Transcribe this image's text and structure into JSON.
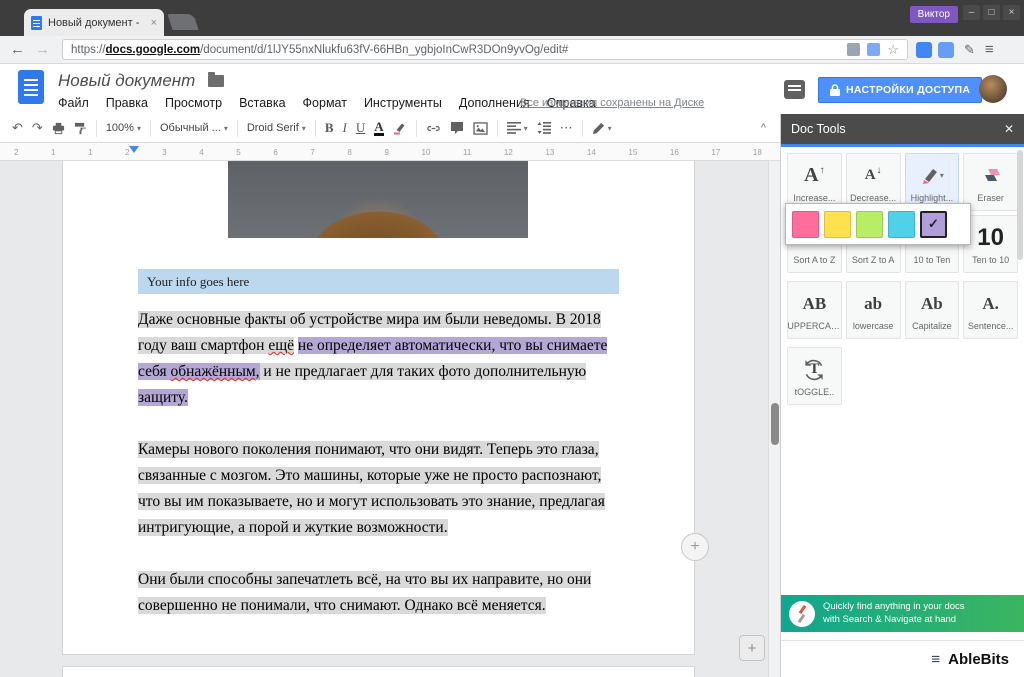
{
  "browser": {
    "tab_title": "Новый документ -",
    "tab_close": "×",
    "profile_label": "Виктор",
    "window_buttons": {
      "minimize": "–",
      "maximize": "□",
      "close": "×"
    },
    "back": "←",
    "forward": "→",
    "url": {
      "scheme": "https://",
      "domain": "docs.google.com",
      "path": "/document/d/1lJY55nxNlukfu63fV-66HBn_ygbjoInCwR3DOn9yvOg/edit#"
    },
    "star": "☆",
    "pencil": "✎",
    "menu": "≡"
  },
  "header": {
    "doc_title": "Новый документ",
    "menus": [
      "Файл",
      "Правка",
      "Просмотр",
      "Вставка",
      "Формат",
      "Инструменты",
      "Дополнения",
      "Справка"
    ],
    "saved_status": "Все изменения сохранены на Диске",
    "share_button": "НАСТРОЙКИ ДОСТУПА"
  },
  "toolbar": {
    "undo": "↶",
    "redo": "↷",
    "zoom": "100%",
    "style": "Обычный ...",
    "font": "Droid Serif",
    "bold": "B",
    "italic": "I",
    "underline": "U",
    "text_color": "A",
    "more": "⋯",
    "caret": "▾",
    "collapse": "^"
  },
  "ruler": {
    "ticks": [
      "2",
      "1",
      "1",
      "2",
      "3",
      "4",
      "5",
      "6",
      "7",
      "8",
      "9",
      "10",
      "11",
      "12",
      "13",
      "14",
      "15",
      "16",
      "17",
      "18"
    ]
  },
  "document": {
    "info_bar": "Your info goes here",
    "p1": {
      "s1": "Даже основные факты об устройстве мира им были неведомы. В 2018 году ваш смартфон ",
      "s2": "ещё",
      "s3": " ",
      "s4": "не определяет автоматически, что вы снимаете себя ",
      "s5": "обнажённым,",
      "s6": " и не предлагает для таких фото дополнительную ",
      "s7": "защиту."
    },
    "p2": "Камеры нового поколения понимают, что они видят. Теперь это глаза, связанные с мозгом. Это машины, которые уже не просто распознают, что вы им показываете, но и могут использовать это знание, предлагая интригующие, а порой и жуткие возможности.",
    "p3": "Они были способны запечатлеть всё, на что вы их направите, но они совершенно не понимали, что снимают. Однако всё меняется.",
    "plus": "+"
  },
  "sidebar": {
    "title": "Doc Tools",
    "close": "✕",
    "tools": {
      "increase": {
        "icon": "A",
        "arrow": "↑",
        "label": "Increase..."
      },
      "decrease": {
        "icon": "A",
        "arrow": "↓",
        "label": "Decrease..."
      },
      "highlight": {
        "label": "Highlight...",
        "caret": "▾"
      },
      "eraser": {
        "label": "Eraser"
      },
      "sort_az": {
        "label": "Sort A to Z"
      },
      "sort_za": {
        "label": "Sort Z to A"
      },
      "ten_to_word": {
        "label": "10 to Ten"
      },
      "word_to_ten": {
        "icon": "10",
        "label": "Ten to 10"
      },
      "uppercase": {
        "icon": "AB",
        "label": "UPPERCASE"
      },
      "lowercase": {
        "icon": "ab",
        "label": "lowercase"
      },
      "capitalize": {
        "icon": "Ab",
        "label": "Capitalize"
      },
      "sentence": {
        "icon": "A.",
        "label": "Sentence..."
      },
      "toggle": {
        "icon": "T",
        "label": "tOGGLE.."
      }
    },
    "palette": {
      "colors": [
        "#ff6d9d",
        "#ffe04d",
        "#b8ee65",
        "#4fd1e8",
        "#b29ddb"
      ],
      "selected_index": 4,
      "check": "✓"
    },
    "banner": {
      "line1": "Quickly find anything in your docs",
      "line2": "with Search & Navigate at hand"
    },
    "brand": "AbleBits",
    "brand_menu": "≡"
  },
  "colors": {
    "accent_blue": "#4d90fe",
    "highlight_gray": "#d9d9d9",
    "highlight_purple": "#b4a7d6",
    "info_bar_blue": "#bcd8ef",
    "doc_tools_header": "#4b4b4b",
    "banner_gradient_start": "#0fa790",
    "banner_gradient_end": "#3cb55e"
  }
}
